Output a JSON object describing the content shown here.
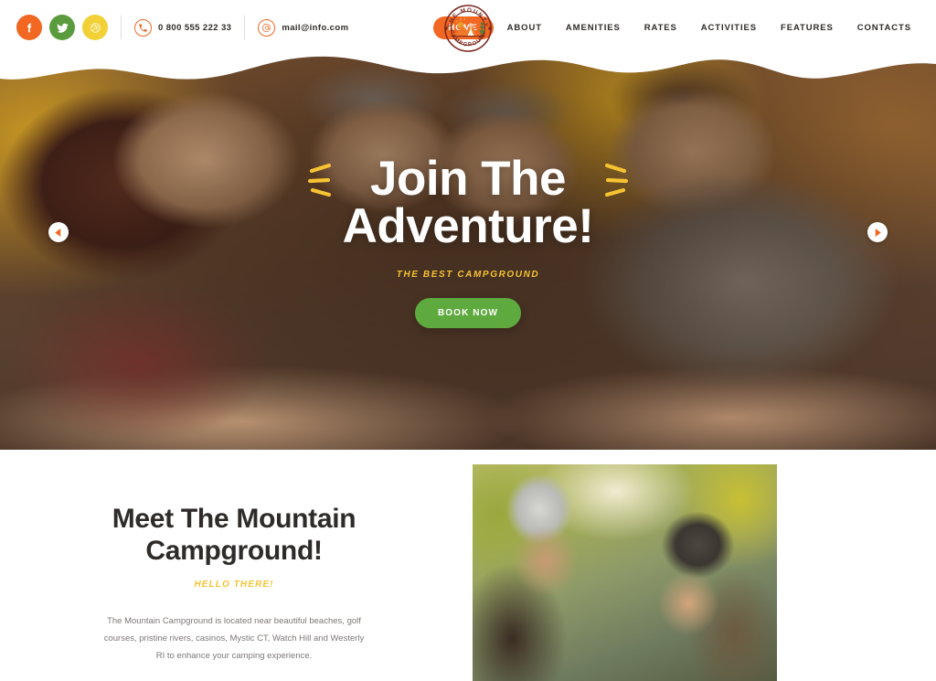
{
  "brand": {
    "name": "THE MOUNTY",
    "sub": "CAMPGROUND",
    "logo_icon": "campground-badge-logo"
  },
  "topbar": {
    "social": [
      {
        "name": "facebook",
        "label": "f",
        "color": "#f26722"
      },
      {
        "name": "twitter",
        "label": "t",
        "color": "#5a9c3d"
      },
      {
        "name": "dribbble",
        "label": "d",
        "color": "#f1d136"
      }
    ],
    "phone": {
      "icon": "phone-icon",
      "text": "0 800 555 222 33"
    },
    "email": {
      "icon": "email-at-icon",
      "text": "mail@info.com"
    }
  },
  "nav": {
    "items": [
      {
        "label": "HOME",
        "active": true
      },
      {
        "label": "ABOUT",
        "active": false
      },
      {
        "label": "AMENITIES",
        "active": false
      },
      {
        "label": "RATES",
        "active": false
      },
      {
        "label": "ACTIVITIES",
        "active": false
      },
      {
        "label": "FEATURES",
        "active": false
      },
      {
        "label": "CONTACTS",
        "active": false
      }
    ]
  },
  "hero": {
    "title_line1": "Join The",
    "title_line2": "Adventure!",
    "subtitle": "THE BEST CAMPGROUND",
    "cta_label": "BOOK NOW",
    "prev_icon": "chevron-left-icon",
    "next_icon": "chevron-right-icon",
    "photo_alt": "family of four smiling in a tent"
  },
  "about": {
    "title_line1": "Meet The Mountain",
    "title_line2": "Campground!",
    "eyebrow": "HELLO THERE!",
    "body": "The Mountain Campground is located near beautiful beaches, golf courses, pristine rivers, casinos, Mystic CT, Watch Hill and Westerly RI to enhance your camping experience.",
    "photo_alt": "couple smiling outdoors by a lake in autumn"
  },
  "colors": {
    "accent_orange": "#f26722",
    "accent_green": "#5faa3f",
    "accent_yellow": "#f6c333",
    "text_dark": "#2e2b28",
    "text_muted": "#7d7a76"
  }
}
